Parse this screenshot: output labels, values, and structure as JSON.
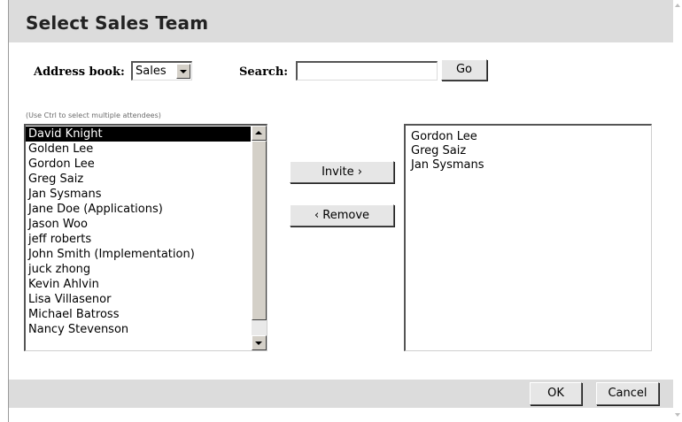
{
  "dialog": {
    "title": "Select Sales Team"
  },
  "address_book": {
    "label": "Address book:",
    "selected": "Sales"
  },
  "search": {
    "label": "Search:",
    "value": "",
    "go_label": "Go"
  },
  "hint": "(Use Ctrl to select multiple attendees)",
  "available": {
    "items": [
      "David Knight",
      "Golden Lee",
      "Gordon Lee",
      "Greg Saiz",
      "Jan Sysmans",
      "Jane Doe (Applications)",
      "Jason Woo",
      "jeff roberts",
      "John Smith (Implementation)",
      "juck zhong",
      "Kevin Ahlvin",
      "Lisa Villasenor",
      "Michael Batross",
      "Nancy Stevenson"
    ],
    "selected_index": 0
  },
  "actions": {
    "invite_label": "Invite ›",
    "remove_label": "‹ Remove"
  },
  "invited": {
    "items": [
      "Gordon Lee",
      "Greg Saiz",
      "Jan Sysmans"
    ]
  },
  "footer": {
    "ok_label": "OK",
    "cancel_label": "Cancel"
  },
  "colors": {
    "header_bg": "#dcdcdc",
    "selection_bg": "#000000",
    "selection_fg": "#ffffff"
  },
  "icons": {
    "dropdown": "chevron-down-icon",
    "scroll_up": "scroll-up-icon",
    "scroll_down": "scroll-down-icon"
  }
}
